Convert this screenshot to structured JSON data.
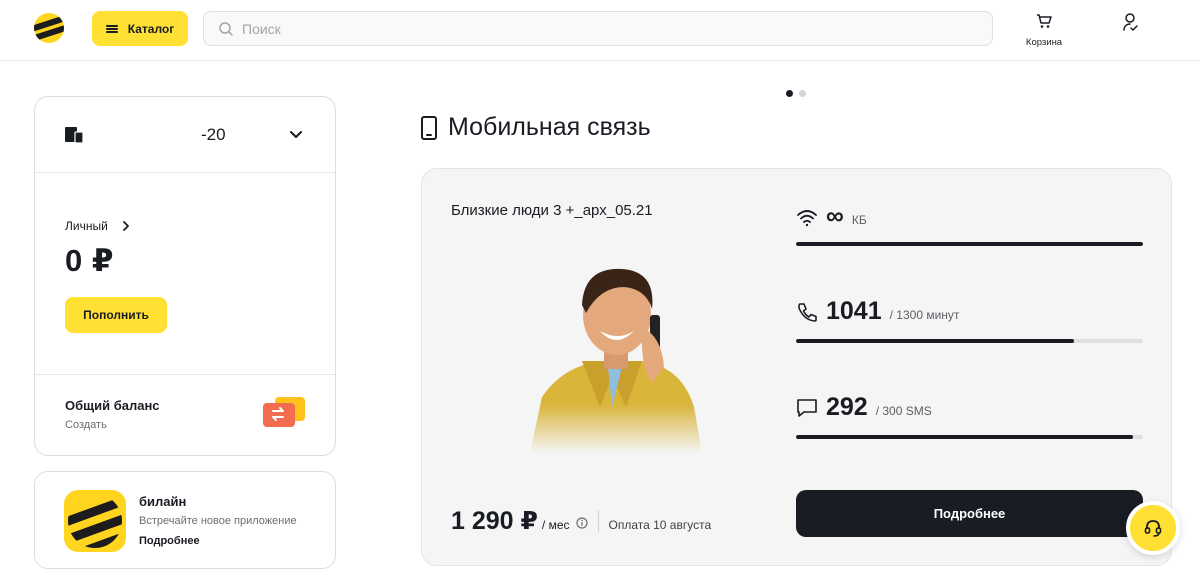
{
  "header": {
    "catalog_label": "Каталог",
    "search_placeholder": "Поиск",
    "cart_label": "Корзина",
    "icons": [
      "beeline-logo",
      "menu-icon",
      "search-icon",
      "cart-icon",
      "profile-icon"
    ]
  },
  "account": {
    "number_suffix": "-20",
    "type_label": "Личный",
    "balance": "0 ₽",
    "topup_label": "Пополнить",
    "shared_title": "Общий баланс",
    "shared_sub": "Создать"
  },
  "app_promo": {
    "title": "билайн",
    "subtitle": "Встречайте новое приложение",
    "link": "Подробнее"
  },
  "main": {
    "title": "Мобильная связь",
    "carousel": {
      "count": 2,
      "active": 1
    },
    "tariff": {
      "name": "Близкие люди 3 +_арх_05.21",
      "price": "1 290 ₽",
      "price_unit": "/ мес",
      "payment_date": "Оплата 10 августа",
      "details_label": "Подробнее",
      "internet": {
        "value": "∞",
        "unit": "КБ",
        "fraction": 1.0
      },
      "minutes": {
        "value": "1041",
        "total": "/ 1300 минут",
        "fraction": 0.8
      },
      "sms": {
        "value": "292",
        "total": "/ 300 SMS",
        "fraction": 0.97
      }
    }
  },
  "colors": {
    "accent": "#ffe033",
    "dark": "#191c22",
    "card_bg": "#f5f5f6"
  }
}
